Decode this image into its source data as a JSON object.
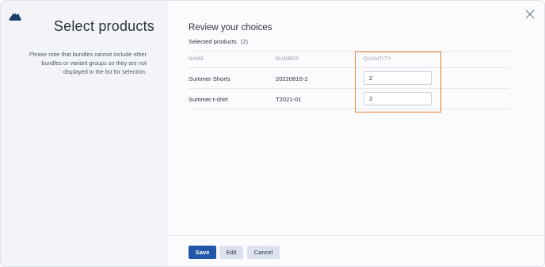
{
  "left_panel": {
    "title": "Select products",
    "note": "Please note that bundles cannot include other bundles or variant groups so they are not displayed in the list for selection."
  },
  "main": {
    "title": "Review your choices",
    "selected_label": "Selected products",
    "selected_count": "(2)",
    "columns": {
      "name": "NAME",
      "number": "NUMBER",
      "quantity": "QUANTITY"
    },
    "rows": [
      {
        "name": "Summer Shorts",
        "number": "20220816-2",
        "quantity": "2"
      },
      {
        "name": "Summer t-shirt",
        "number": "T2021-01",
        "quantity": "2"
      }
    ]
  },
  "footer": {
    "save_label": "Save",
    "edit_label": "Edit",
    "cancel_label": "Cancel"
  },
  "icons": {
    "logo": "mountain-logo-icon",
    "close": "close-icon"
  },
  "colors": {
    "primary": "#2157a8",
    "highlight": "#e97d2d",
    "secondary_button": "#dde3ee"
  }
}
